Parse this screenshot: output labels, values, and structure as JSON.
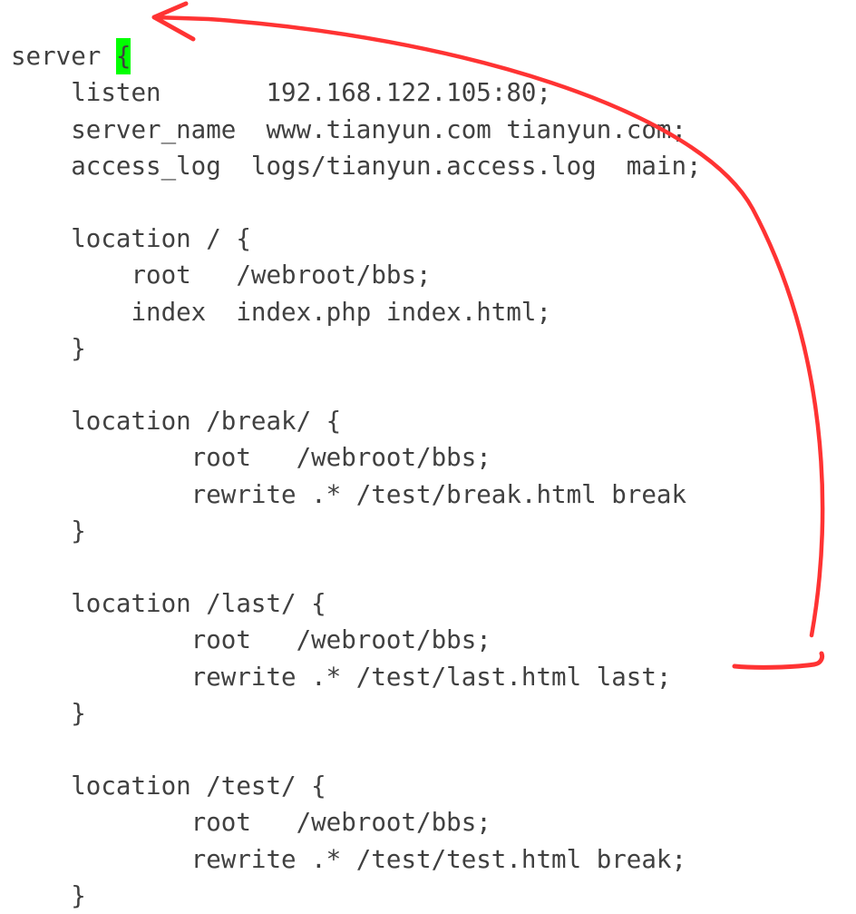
{
  "lines": {
    "l1_pre": "server ",
    "l1_cursor": "{",
    "l2": "    listen       192.168.122.105:80;",
    "l3": "    server_name  www.tianyun.com tianyun.com;",
    "l4": "    access_log  logs/tianyun.access.log  main;",
    "l5": "",
    "l6": "    location / {",
    "l7": "        root   /webroot/bbs;",
    "l8": "        index  index.php index.html;",
    "l9": "    }",
    "l10": "",
    "l11": "    location /break/ {",
    "l12": "            root   /webroot/bbs;",
    "l13": "            rewrite .* /test/break.html break",
    "l14": "    }",
    "l15": "",
    "l16": "    location /last/ {",
    "l17": "            root   /webroot/bbs;",
    "l18": "            rewrite .* /test/last.html last;",
    "l19": "    }",
    "l20": "",
    "l21": "    location /test/ {",
    "l22": "            root   /webroot/bbs;",
    "l23": "            rewrite .* /test/test.html break;",
    "l24": "    }"
  },
  "highlight_color": "#00ff00",
  "annotation_color": "#ff3333"
}
